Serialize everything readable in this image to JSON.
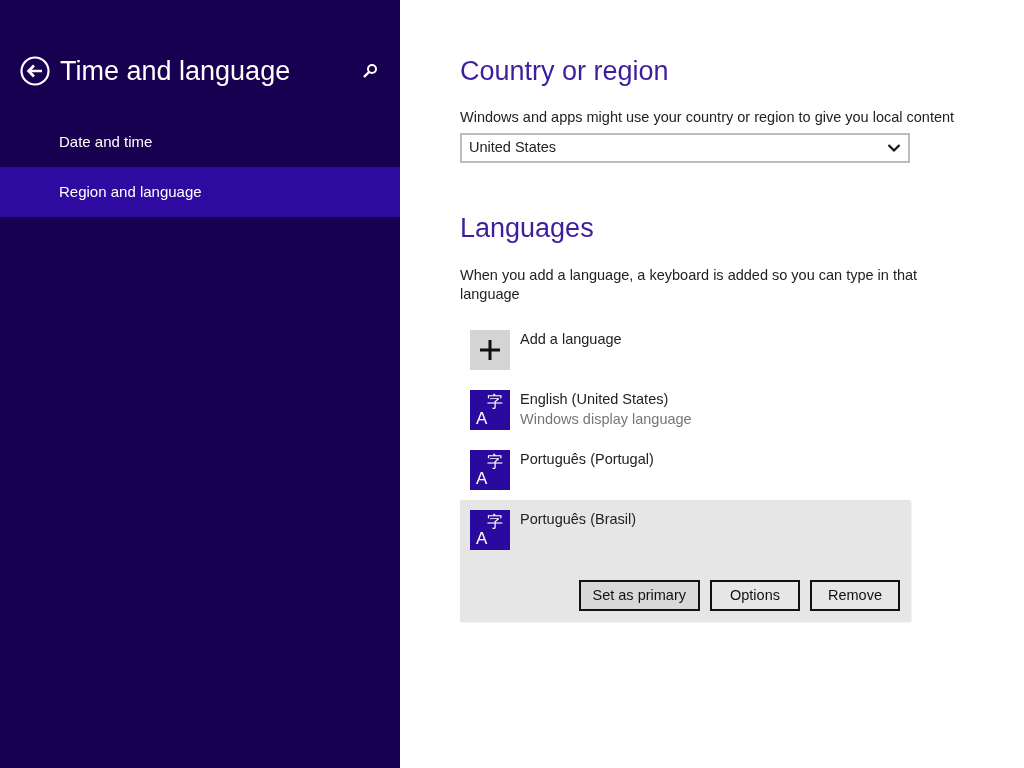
{
  "sidebar": {
    "title": "Time and language",
    "items": [
      {
        "label": "Date and time",
        "selected": false
      },
      {
        "label": "Region and language",
        "selected": true
      }
    ]
  },
  "country": {
    "heading": "Country or region",
    "description": "Windows and apps might use your country or region to give you local content",
    "value": "United States"
  },
  "languages": {
    "heading": "Languages",
    "description": "When you add a language, a keyboard is added so you can type in that language",
    "items": [
      {
        "kind": "add",
        "label": "Add a language",
        "selected": false
      },
      {
        "kind": "language",
        "label": "English (United States)",
        "subtitle": "Windows display language",
        "icon_letter": "A",
        "icon_character": "字",
        "selected": false
      },
      {
        "kind": "language",
        "label": "Português (Portugal)",
        "icon_letter": "A",
        "icon_character": "字",
        "selected": false
      },
      {
        "kind": "language",
        "label": "Português (Brasil)",
        "icon_letter": "A",
        "icon_character": "字",
        "selected": true,
        "buttons": [
          "Set as primary",
          "Options",
          "Remove"
        ]
      }
    ]
  }
}
